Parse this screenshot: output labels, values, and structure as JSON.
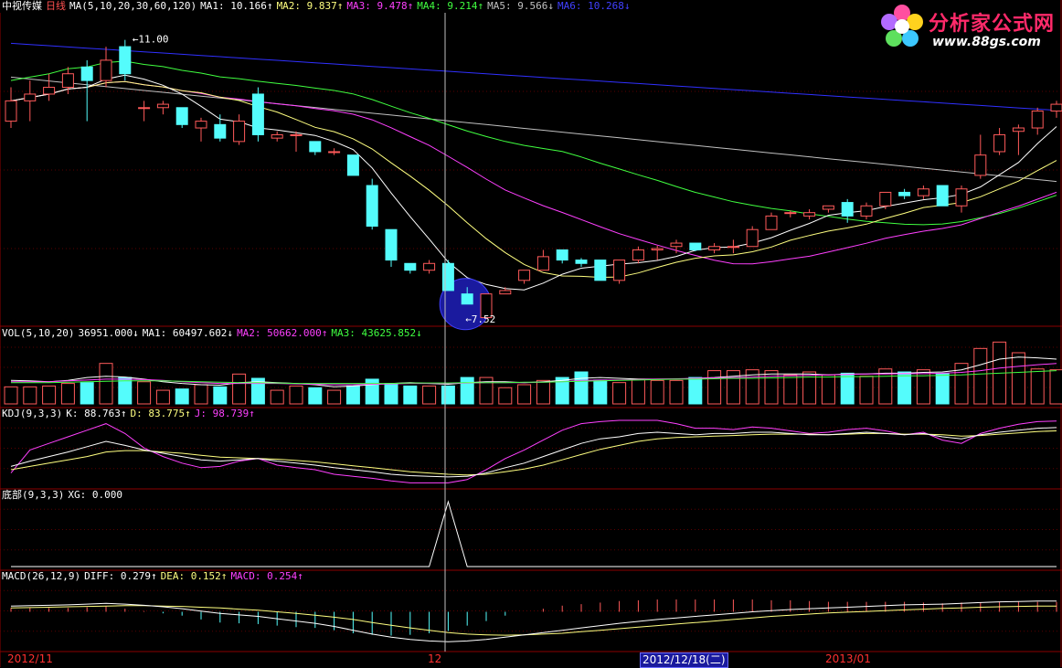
{
  "main_panel": {
    "stock_name": "中视传媒",
    "period": "日线",
    "indicator": "MA(5,10,20,30,60,120)",
    "ma_values": [
      {
        "label": "MA1:",
        "value": "10.166",
        "arrow": "↑",
        "color": "#ffffff"
      },
      {
        "label": "MA2:",
        "value": "9.837",
        "arrow": "↑",
        "color": "#ffff80"
      },
      {
        "label": "MA3:",
        "value": "9.478",
        "arrow": "↑",
        "color": "#ff40ff"
      },
      {
        "label": "MA4:",
        "value": "9.214",
        "arrow": "↑",
        "color": "#40ff40"
      },
      {
        "label": "MA5:",
        "value": "9.566",
        "arrow": "↓",
        "color": "#c0c0c0"
      },
      {
        "label": "MA6:",
        "value": "10.268",
        "arrow": "↓",
        "color": "#4040ff"
      }
    ],
    "high_label": "11.00",
    "low_label": "7.52"
  },
  "vol_panel": {
    "indicator": "VOL(5,10,20)",
    "values": [
      {
        "label": "",
        "value": "36951.000",
        "arrow": "↓",
        "color": "#ffffff"
      },
      {
        "label": "MA1:",
        "value": "60497.602",
        "arrow": "↓",
        "color": "#ffffff"
      },
      {
        "label": "MA2:",
        "value": "50662.000",
        "arrow": "↑",
        "color": "#ff40ff"
      },
      {
        "label": "MA3:",
        "value": "43625.852",
        "arrow": "↓",
        "color": "#40ff40"
      }
    ]
  },
  "kdj_panel": {
    "indicator": "KDJ(9,3,3)",
    "values": [
      {
        "label": "K:",
        "value": "88.763",
        "arrow": "↑",
        "color": "#ffffff"
      },
      {
        "label": "D:",
        "value": "83.775",
        "arrow": "↑",
        "color": "#ffff80"
      },
      {
        "label": "J:",
        "value": "98.739",
        "arrow": "↑",
        "color": "#ff40ff"
      }
    ]
  },
  "bottom_panel": {
    "indicator": "底部(9,3,3)",
    "values": [
      {
        "label": "XG:",
        "value": "0.000",
        "arrow": "",
        "color": "#ffffff"
      }
    ]
  },
  "macd_panel": {
    "indicator": "MACD(26,12,9)",
    "values": [
      {
        "label": "DIFF:",
        "value": "0.279",
        "arrow": "↑",
        "color": "#ffffff"
      },
      {
        "label": "DEA:",
        "value": "0.152",
        "arrow": "↑",
        "color": "#ffff80"
      },
      {
        "label": "MACD:",
        "value": "0.254",
        "arrow": "↑",
        "color": "#ff40ff"
      }
    ]
  },
  "x_axis": {
    "labels": [
      "2012/11",
      "12",
      "2012/12/18(二)",
      "2013/01"
    ]
  },
  "logo": {
    "title": "分析家公式网",
    "url": "www.88gs.com"
  },
  "colors": {
    "up": "#ff5a5a",
    "down": "#54fcfc",
    "grid": "#8b0000",
    "crosshair": "#c0c0c0",
    "highlight_circle": "#1a1a9e"
  },
  "chart_data": {
    "type": "candlestick",
    "candles": [
      {
        "o": 9.8,
        "h": 10.3,
        "l": 9.7,
        "c": 10.1
      },
      {
        "o": 10.1,
        "h": 10.4,
        "l": 9.8,
        "c": 10.2
      },
      {
        "o": 10.2,
        "h": 10.5,
        "l": 10.1,
        "c": 10.3
      },
      {
        "o": 10.3,
        "h": 10.6,
        "l": 10.2,
        "c": 10.5
      },
      {
        "o": 10.6,
        "h": 10.7,
        "l": 9.8,
        "c": 10.4
      },
      {
        "o": 10.4,
        "h": 10.9,
        "l": 10.3,
        "c": 10.7
      },
      {
        "o": 10.9,
        "h": 11.0,
        "l": 10.4,
        "c": 10.5
      },
      {
        "o": 10.0,
        "h": 10.1,
        "l": 9.8,
        "c": 10.0
      },
      {
        "o": 10.0,
        "h": 10.1,
        "l": 9.9,
        "c": 10.05
      },
      {
        "o": 10.0,
        "h": 10.0,
        "l": 9.7,
        "c": 9.75
      },
      {
        "o": 9.7,
        "h": 9.85,
        "l": 9.5,
        "c": 9.8
      },
      {
        "o": 9.75,
        "h": 9.9,
        "l": 9.5,
        "c": 9.55
      },
      {
        "o": 9.5,
        "h": 9.9,
        "l": 9.45,
        "c": 9.8
      },
      {
        "o": 10.2,
        "h": 10.3,
        "l": 9.5,
        "c": 9.6
      },
      {
        "o": 9.55,
        "h": 9.65,
        "l": 9.5,
        "c": 9.6
      },
      {
        "o": 9.6,
        "h": 9.65,
        "l": 9.35,
        "c": 9.6
      },
      {
        "o": 9.5,
        "h": 9.5,
        "l": 9.3,
        "c": 9.35
      },
      {
        "o": 9.35,
        "h": 9.4,
        "l": 9.3,
        "c": 9.35
      },
      {
        "o": 9.3,
        "h": 9.3,
        "l": 9.0,
        "c": 9.0
      },
      {
        "o": 8.85,
        "h": 8.95,
        "l": 8.2,
        "c": 8.25
      },
      {
        "o": 8.2,
        "h": 8.2,
        "l": 7.65,
        "c": 7.75
      },
      {
        "o": 7.7,
        "h": 7.7,
        "l": 7.55,
        "c": 7.6
      },
      {
        "o": 7.6,
        "h": 7.75,
        "l": 7.55,
        "c": 7.7
      },
      {
        "o": 7.7,
        "h": 7.75,
        "l": 7.35,
        "c": 7.3
      },
      {
        "o": 7.25,
        "h": 7.35,
        "l": 7.12,
        "c": 7.1
      },
      {
        "o": 6.9,
        "h": 7.25,
        "l": 6.88,
        "c": 7.25
      },
      {
        "o": 7.25,
        "h": 7.35,
        "l": 7.25,
        "c": 7.3
      },
      {
        "o": 7.45,
        "h": 7.6,
        "l": 7.4,
        "c": 7.6
      },
      {
        "o": 7.6,
        "h": 7.9,
        "l": 7.6,
        "c": 7.8
      },
      {
        "o": 7.9,
        "h": 7.9,
        "l": 7.7,
        "c": 7.75
      },
      {
        "o": 7.75,
        "h": 7.78,
        "l": 7.65,
        "c": 7.7
      },
      {
        "o": 7.75,
        "h": 7.75,
        "l": 7.48,
        "c": 7.45
      },
      {
        "o": 7.45,
        "h": 7.75,
        "l": 7.4,
        "c": 7.75
      },
      {
        "o": 7.75,
        "h": 7.95,
        "l": 7.7,
        "c": 7.9
      },
      {
        "o": 7.9,
        "h": 7.96,
        "l": 7.75,
        "c": 7.92
      },
      {
        "o": 7.95,
        "h": 8.05,
        "l": 7.85,
        "c": 8.0
      },
      {
        "o": 8.0,
        "h": 8.0,
        "l": 7.88,
        "c": 7.9
      },
      {
        "o": 7.9,
        "h": 8.0,
        "l": 7.85,
        "c": 7.95
      },
      {
        "o": 7.95,
        "h": 8.05,
        "l": 7.85,
        "c": 7.95
      },
      {
        "o": 7.95,
        "h": 8.25,
        "l": 7.95,
        "c": 8.2
      },
      {
        "o": 8.2,
        "h": 8.45,
        "l": 8.2,
        "c": 8.4
      },
      {
        "o": 8.45,
        "h": 8.48,
        "l": 8.38,
        "c": 8.45
      },
      {
        "o": 8.4,
        "h": 8.5,
        "l": 8.35,
        "c": 8.45
      },
      {
        "o": 8.5,
        "h": 8.55,
        "l": 8.45,
        "c": 8.55
      },
      {
        "o": 8.6,
        "h": 8.65,
        "l": 8.3,
        "c": 8.4
      },
      {
        "o": 8.4,
        "h": 8.6,
        "l": 8.35,
        "c": 8.55
      },
      {
        "o": 8.55,
        "h": 8.7,
        "l": 8.5,
        "c": 8.75
      },
      {
        "o": 8.75,
        "h": 8.8,
        "l": 8.65,
        "c": 8.7
      },
      {
        "o": 8.7,
        "h": 8.85,
        "l": 8.65,
        "c": 8.8
      },
      {
        "o": 8.85,
        "h": 8.85,
        "l": 8.55,
        "c": 8.55
      },
      {
        "o": 8.55,
        "h": 8.85,
        "l": 8.45,
        "c": 8.8
      },
      {
        "o": 9.0,
        "h": 9.6,
        "l": 8.95,
        "c": 9.3
      },
      {
        "o": 9.35,
        "h": 9.7,
        "l": 9.3,
        "c": 9.6
      },
      {
        "o": 9.65,
        "h": 9.75,
        "l": 9.3,
        "c": 9.7
      },
      {
        "o": 9.7,
        "h": 10.0,
        "l": 9.6,
        "c": 9.95
      },
      {
        "o": 9.95,
        "h": 10.1,
        "l": 9.85,
        "c": 10.05
      }
    ],
    "volume": [
      40,
      40,
      42,
      48,
      50,
      95,
      62,
      52,
      32,
      35,
      45,
      40,
      70,
      60,
      32,
      42,
      38,
      32,
      42,
      58,
      48,
      42,
      42,
      42,
      62,
      62,
      38,
      45,
      55,
      62,
      75,
      56,
      50,
      58,
      55,
      55,
      62,
      78,
      78,
      80,
      78,
      68,
      75,
      68,
      72,
      65,
      82,
      75,
      80,
      72,
      95,
      130,
      145,
      120,
      82,
      80
    ],
    "vol_ma": {
      "MA1": [
        55,
        54,
        52,
        55,
        62,
        65,
        63,
        58,
        52,
        48,
        45,
        44,
        50,
        52,
        50,
        48,
        45,
        40,
        42,
        45,
        48,
        50,
        48,
        46,
        50,
        52,
        52,
        50,
        52,
        55,
        60,
        62,
        60,
        58,
        58,
        58,
        60,
        62,
        65,
        68,
        70,
        70,
        70,
        68,
        70,
        70,
        72,
        72,
        74,
        75,
        80,
        92,
        105,
        110,
        108,
        105
      ],
      "MA2": [
        52,
        52,
        52,
        54,
        56,
        58,
        58,
        57,
        55,
        52,
        50,
        48,
        48,
        48,
        48,
        47,
        46,
        45,
        45,
        46,
        47,
        48,
        48,
        48,
        49,
        50,
        50,
        50,
        51,
        52,
        55,
        56,
        56,
        57,
        58,
        59,
        60,
        61,
        62,
        63,
        65,
        66,
        67,
        68,
        69,
        70,
        70,
        71,
        71,
        72,
        74,
        78,
        84,
        88,
        92,
        95
      ],
      "MA3": [
        50,
        50,
        50,
        51,
        52,
        53,
        54,
        54,
        54,
        53,
        52,
        51,
        50,
        50,
        49,
        48,
        48,
        48,
        48,
        48,
        48,
        49,
        49,
        49,
        50,
        50,
        50,
        51,
        51,
        52,
        53,
        54,
        55,
        56,
        57,
        58,
        58,
        59,
        60,
        60,
        61,
        62,
        63,
        63,
        64,
        64,
        65,
        66,
        66,
        67,
        68,
        70,
        72,
        74,
        76,
        78
      ]
    },
    "kdj": {
      "K": [
        30,
        38,
        45,
        52,
        60,
        68,
        62,
        55,
        50,
        45,
        40,
        38,
        40,
        42,
        38,
        35,
        32,
        28,
        25,
        22,
        18,
        16,
        15,
        14,
        15,
        20,
        28,
        35,
        45,
        55,
        65,
        72,
        75,
        80,
        82,
        80,
        78,
        80,
        80,
        82,
        82,
        80,
        78,
        78,
        80,
        82,
        80,
        78,
        80,
        75,
        72,
        78,
        82,
        85,
        88,
        89
      ],
      "D": [
        25,
        30,
        35,
        40,
        45,
        52,
        54,
        54,
        52,
        50,
        47,
        44,
        43,
        42,
        41,
        39,
        37,
        34,
        31,
        28,
        25,
        22,
        20,
        18,
        17,
        18,
        22,
        26,
        32,
        40,
        48,
        56,
        62,
        68,
        72,
        74,
        75,
        76,
        77,
        78,
        79,
        79,
        79,
        78,
        79,
        80,
        80,
        79,
        79,
        78,
        76,
        77,
        79,
        81,
        83,
        84
      ],
      "J": [
        20,
        55,
        65,
        75,
        85,
        95,
        80,
        58,
        45,
        35,
        28,
        30,
        38,
        42,
        32,
        28,
        25,
        18,
        15,
        12,
        8,
        5,
        5,
        5,
        10,
        25,
        42,
        55,
        70,
        85,
        95,
        98,
        100,
        100,
        100,
        95,
        88,
        88,
        86,
        90,
        88,
        84,
        80,
        82,
        86,
        88,
        84,
        78,
        82,
        70,
        65,
        80,
        88,
        94,
        98,
        99
      ]
    },
    "xg": [
      0,
      0,
      0,
      0,
      0,
      0,
      0,
      0,
      0,
      0,
      0,
      0,
      0,
      0,
      0,
      0,
      0,
      0,
      0,
      0,
      0,
      0,
      0,
      1,
      0,
      0,
      0,
      0,
      0,
      0,
      0,
      0,
      0,
      0,
      0,
      0,
      0,
      0,
      0,
      0,
      0,
      0,
      0,
      0,
      0,
      0,
      0,
      0,
      0,
      0,
      0,
      0,
      0,
      0,
      0,
      0
    ],
    "macd": {
      "DIFF": [
        0.15,
        0.16,
        0.17,
        0.18,
        0.2,
        0.22,
        0.2,
        0.17,
        0.13,
        0.08,
        0.02,
        -0.04,
        -0.08,
        -0.12,
        -0.18,
        -0.24,
        -0.3,
        -0.38,
        -0.48,
        -0.58,
        -0.66,
        -0.72,
        -0.76,
        -0.78,
        -0.76,
        -0.72,
        -0.66,
        -0.6,
        -0.54,
        -0.48,
        -0.42,
        -0.36,
        -0.3,
        -0.25,
        -0.2,
        -0.16,
        -0.12,
        -0.08,
        -0.04,
        0.0,
        0.03,
        0.06,
        0.08,
        0.1,
        0.12,
        0.14,
        0.16,
        0.18,
        0.19,
        0.2,
        0.22,
        0.24,
        0.26,
        0.27,
        0.28,
        0.28
      ],
      "DEA": [
        0.1,
        0.11,
        0.12,
        0.13,
        0.14,
        0.15,
        0.16,
        0.16,
        0.15,
        0.14,
        0.12,
        0.1,
        0.07,
        0.04,
        0.0,
        -0.04,
        -0.09,
        -0.14,
        -0.2,
        -0.28,
        -0.35,
        -0.42,
        -0.48,
        -0.54,
        -0.58,
        -0.6,
        -0.61,
        -0.6,
        -0.58,
        -0.56,
        -0.52,
        -0.48,
        -0.44,
        -0.4,
        -0.36,
        -0.32,
        -0.28,
        -0.24,
        -0.2,
        -0.16,
        -0.12,
        -0.09,
        -0.06,
        -0.03,
        -0.01,
        0.01,
        0.03,
        0.05,
        0.07,
        0.09,
        0.1,
        0.12,
        0.13,
        0.14,
        0.15,
        0.15
      ],
      "BAR": [
        0.1,
        0.1,
        0.1,
        0.1,
        0.12,
        0.14,
        0.08,
        0.02,
        -0.04,
        -0.1,
        -0.2,
        -0.28,
        -0.3,
        -0.32,
        -0.36,
        -0.4,
        -0.42,
        -0.48,
        -0.56,
        -0.6,
        -0.62,
        -0.6,
        -0.56,
        -0.5,
        -0.36,
        -0.24,
        -0.1,
        0.0,
        0.08,
        0.16,
        0.2,
        0.24,
        0.28,
        0.3,
        0.32,
        0.32,
        0.32,
        0.32,
        0.32,
        0.32,
        0.3,
        0.3,
        0.28,
        0.26,
        0.26,
        0.26,
        0.26,
        0.26,
        0.24,
        0.22,
        0.24,
        0.24,
        0.26,
        0.26,
        0.26,
        0.26
      ]
    },
    "price_range": [
      6.8,
      11.4
    ]
  }
}
